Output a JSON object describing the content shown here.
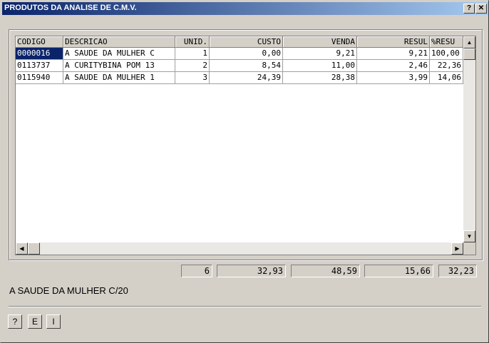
{
  "window": {
    "title": "PRODUTOS DA ANALISE DE C.M.V.",
    "help_btn": "?",
    "close_btn": "✕"
  },
  "table": {
    "columns": [
      "CODIGO",
      "DESCRICAO",
      "UNID.",
      "CUSTO",
      "VENDA",
      "RESUL",
      "%RESU"
    ],
    "rows": [
      [
        "0000016",
        "A SAUDE DA MULHER C",
        "1",
        "0,00",
        "9,21",
        "9,21",
        "100,00"
      ],
      [
        "0113737",
        "A CURITYBINA POM 13",
        "2",
        "8,54",
        "11,00",
        "2,46",
        "22,36"
      ],
      [
        "0115940",
        "A SAUDE DA MULHER 1",
        "3",
        "24,39",
        "28,38",
        "3,99",
        "14,06"
      ]
    ]
  },
  "totals": {
    "unid": "6",
    "custo": "32,93",
    "venda": "48,59",
    "resul": "15,66",
    "pct": "32,23"
  },
  "selected_description": "A SAUDE DA MULHER C/20",
  "buttons": {
    "help": "?",
    "e": "E",
    "i": "I"
  },
  "scroll": {
    "up": "▲",
    "down": "▼",
    "left": "◀",
    "right": "▶"
  }
}
